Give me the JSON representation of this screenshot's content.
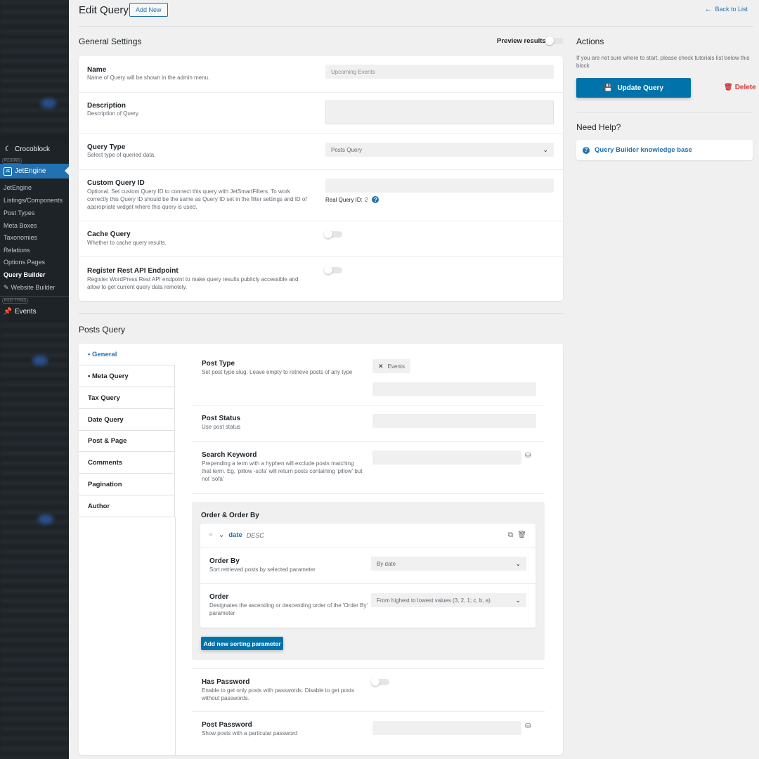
{
  "sidebar": {
    "section_plugins": "PLUGINS",
    "section_post_types": "POST TYPES",
    "crocoblock": "Crocoblock",
    "jetengine": "JetEngine",
    "items": [
      "JetEngine",
      "Listings/Components",
      "Post Types",
      "Meta Boxes",
      "Taxonomies",
      "Relations",
      "Options Pages",
      "Query Builder",
      "Website Builder"
    ],
    "events": "Events"
  },
  "header": {
    "title": "Edit Query",
    "add_new": "Add New",
    "back": "Back to List"
  },
  "general": {
    "title": "General Settings",
    "preview": "Preview results",
    "name_label": "Name",
    "name_desc": "Name of Query will be shown in the admin menu.",
    "name_value": "Upcoming Events",
    "description_label": "Description",
    "description_desc": "Description of Query.",
    "query_type_label": "Query Type",
    "query_type_desc": "Select type of queried data.",
    "query_type_value": "Posts Query",
    "custom_id_label": "Custom Query ID",
    "custom_id_desc": "Optional. Set custom Query ID to connect this query with JetSmartFilters. To work correctly this Query ID should be the same as Query ID set in the filter settings and ID of appropriate widget where this query is used.",
    "real_id_label": "Real Query ID:",
    "real_id_value": "2",
    "cache_label": "Cache Query",
    "cache_desc": "Whether to cache query results.",
    "rest_label": "Register Rest API Endpoint",
    "rest_desc": "Register WordPress Rest API endpoint to make query results publicly accessible and allow to get current query data remotely."
  },
  "actions": {
    "title": "Actions",
    "hint": "If you are not sure where to start, please check tutorials list below this block",
    "update": "Update Query",
    "delete": "Delete",
    "help_title": "Need Help?",
    "kb_link": "Query Builder knowledge base"
  },
  "posts_query": {
    "title": "Posts Query",
    "tabs": [
      "• General",
      "• Meta Query",
      "Tax Query",
      "Date Query",
      "Post & Page",
      "Comments",
      "Pagination",
      "Author"
    ],
    "post_type_label": "Post Type",
    "post_type_desc": "Set post type slug. Leave empty to retrieve posts of any type",
    "post_type_chip": "Events",
    "post_status_label": "Post Status",
    "post_status_desc": "Use post status",
    "search_label": "Search Keyword",
    "search_desc": "Prepending a term with a hyphen will exclude posts matching that term. Eg, 'pillow -sofa' will return posts containing 'pillow' but not 'sofa'",
    "order_title": "Order & Order By",
    "order_item_name": "date",
    "order_item_dir": "DESC",
    "order_by_label": "Order By",
    "order_by_desc": "Sort retrieved posts by selected parameter",
    "order_by_value": "By date",
    "order_label": "Order",
    "order_desc": "Designates the ascending or descending order of the 'Order By' parameter",
    "order_value": "From highest to lowest values (3, 2, 1; c, b, a)",
    "add_sort": "Add new sorting parameter",
    "has_password_label": "Has Password",
    "has_password_desc": "Enable to get only posts with passwords. Disable to get posts without passwords.",
    "post_password_label": "Post Password",
    "post_password_desc": "Show posts with a particular password"
  },
  "colors": {
    "accent": "#2271b1",
    "primary_button": "#0073aa",
    "delete": "#d63638",
    "sidebar": "#1d2327"
  }
}
